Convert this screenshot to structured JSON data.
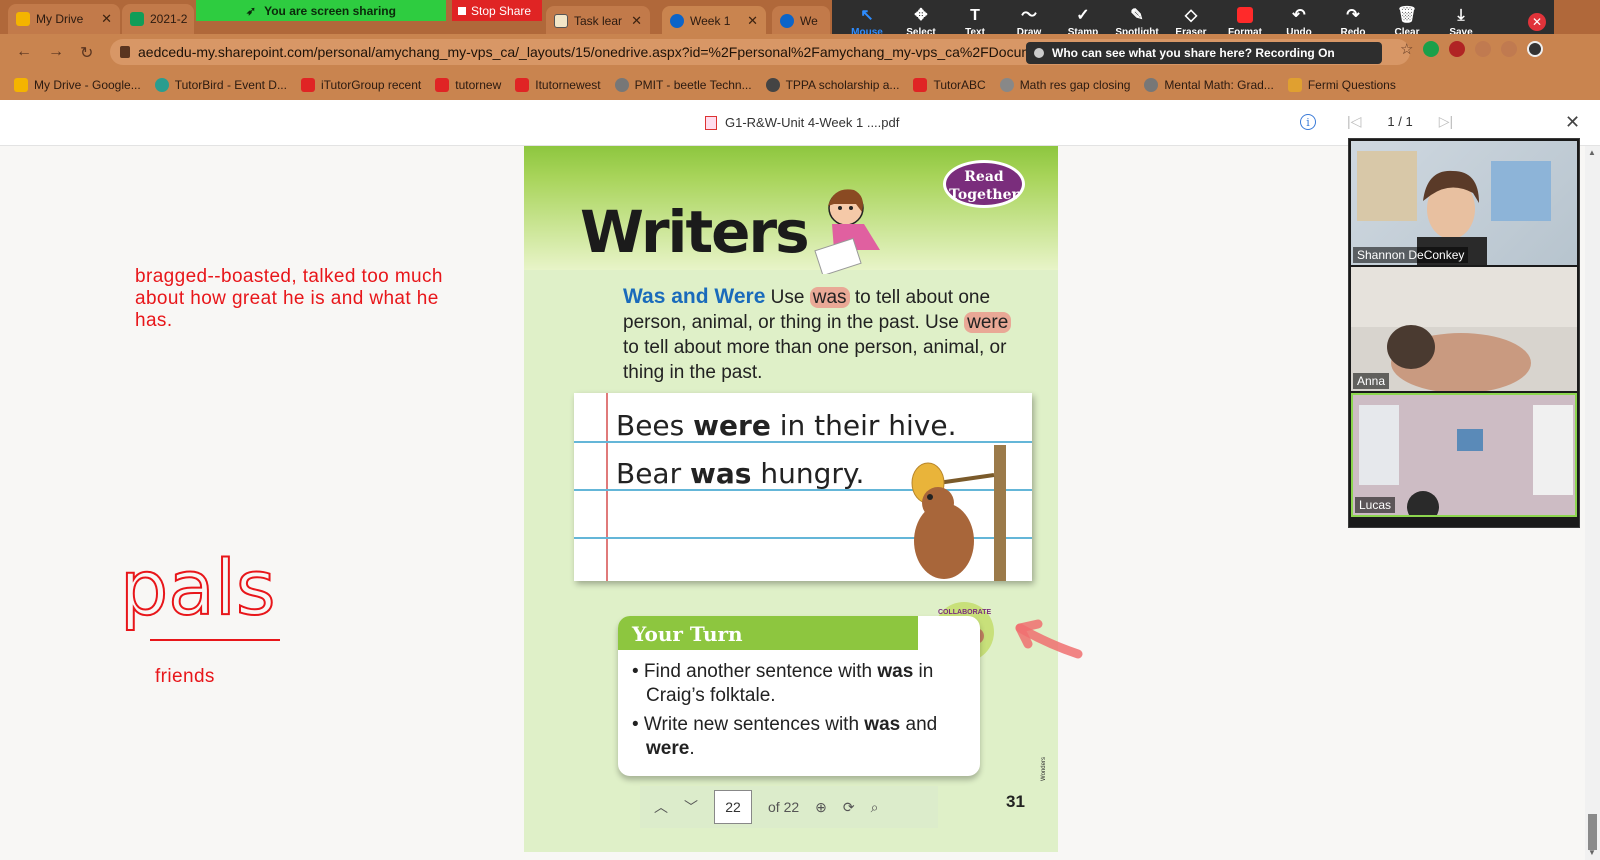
{
  "tabs": [
    {
      "label": "My Drive",
      "color": "#f4b400"
    },
    {
      "label": "2021-2",
      "color": "#0f9d58"
    },
    {
      "label": "Task lear",
      "color": "#f2e6c8"
    },
    {
      "label": "Week 1",
      "color": "#0b64c9"
    },
    {
      "label": "We",
      "color": "#0b64c9"
    }
  ],
  "share": {
    "sharing_label": "You are screen sharing",
    "stop_label": "Stop Share"
  },
  "annotation_tools": [
    {
      "label": "Mouse",
      "icon": "↖"
    },
    {
      "label": "Select",
      "icon": "✥"
    },
    {
      "label": "Text",
      "icon": "T"
    },
    {
      "label": "Draw",
      "icon": "〜"
    },
    {
      "label": "Stamp",
      "icon": "✓"
    },
    {
      "label": "Spotlight",
      "icon": "✎"
    },
    {
      "label": "Eraser",
      "icon": "◇"
    },
    {
      "label": "Format",
      "icon": "■"
    },
    {
      "label": "Undo",
      "icon": "↶"
    },
    {
      "label": "Redo",
      "icon": "↷"
    },
    {
      "label": "Clear",
      "icon": "🗑"
    },
    {
      "label": "Save",
      "icon": "⤓"
    }
  ],
  "address": {
    "url": "aedcedu-my.sharepoint.com/personal/amychang_my-vps_ca/_layouts/15/onedrive.aspx?id=%2Fpersonal%2Famychang_my-vps_ca%2FDocume"
  },
  "who_banner": "Who can see what you share here? Recording On",
  "bookmarks": [
    {
      "label": "My Drive - Google...",
      "color": "#f4b400"
    },
    {
      "label": "TutorBird - Event D...",
      "color": "#2a9d8f"
    },
    {
      "label": "iTutorGroup recent",
      "color": "#e02424"
    },
    {
      "label": "tutornew",
      "color": "#e02424"
    },
    {
      "label": "Itutornewest",
      "color": "#e02424"
    },
    {
      "label": "PMIT - beetle Techn...",
      "color": "#777777"
    },
    {
      "label": "TPPA scholarship a...",
      "color": "#444444"
    },
    {
      "label": "TutorABC",
      "color": "#e02424"
    },
    {
      "label": "Math res gap closing",
      "color": "#888888"
    },
    {
      "label": "Mental Math: Grad...",
      "color": "#777777"
    },
    {
      "label": "Fermi Questions",
      "color": "#e0a030"
    }
  ],
  "viewer": {
    "doc_title": "G1-R&W-Unit 4-Week 1 ....pdf",
    "page_counter": "1 / 1"
  },
  "annotations": {
    "note": "bragged--boasted, talked too much about how great he is and what he has.",
    "word": "pals",
    "word_meaning": "friends"
  },
  "pdf": {
    "header": "Writers",
    "badge": "Read Together",
    "rule_title": "Was and Were",
    "rule_p1": " Use ",
    "rule_was": "was",
    "rule_p2": " to tell about one person, animal, or thing in the past. Use ",
    "rule_were": "were ",
    "rule_p3": "to tell about more than one person, animal, or thing in the past.",
    "s1_a": "Bees ",
    "s1_b": "were",
    "s1_c": " in their hive.",
    "s2_a": "Bear ",
    "s2_b": "was",
    "s2_c": " hungry.",
    "your_turn": "Your Turn",
    "collaborate": "COLLABORATE",
    "b1_a": "• Find another sentence with ",
    "b1_b": "was",
    "b1_c": " in Craig’s folktale.",
    "b2_a": "• Write new sentences with ",
    "b2_b": "was",
    "b2_c": " and ",
    "b2_d": "were",
    "b2_e": ".",
    "page_number": "31",
    "toolbar_page": "22",
    "toolbar_of": "of 22",
    "wonders": "Wonders"
  },
  "participants": [
    {
      "name": "Shannon DeConkey"
    },
    {
      "name": "Anna"
    },
    {
      "name": "Lucas"
    }
  ],
  "colors": {
    "annotation_red": "#e8161a",
    "zoom_blue": "#2d8cff",
    "share_green": "#2ecc40"
  }
}
